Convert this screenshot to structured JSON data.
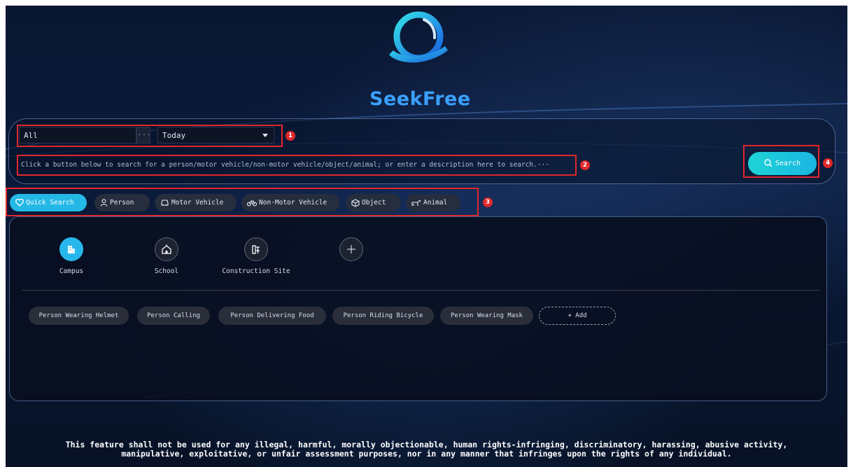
{
  "app": {
    "name": "SeekFree"
  },
  "filters": {
    "scope_value": "All",
    "scope_more": "···",
    "time_value": "Today"
  },
  "search": {
    "placeholder": "Click a button below to search for a person/motor vehicle/non-motor vehicle/object/animal; or enter a description here to search.···",
    "button_label": "Search"
  },
  "tabs": [
    {
      "label": "Quick Search",
      "icon": "heart-icon",
      "active": true
    },
    {
      "label": "Person",
      "icon": "person-icon"
    },
    {
      "label": "Motor Vehicle",
      "icon": "car-icon"
    },
    {
      "label": "Non-Motor Vehicle",
      "icon": "bicycle-icon"
    },
    {
      "label": "Object",
      "icon": "cube-icon"
    },
    {
      "label": "Animal",
      "icon": "animal-icon"
    }
  ],
  "scenes": [
    {
      "label": "Campus",
      "icon": "building-icon",
      "active": true
    },
    {
      "label": "School",
      "icon": "school-icon"
    },
    {
      "label": "Construction Site",
      "icon": "construction-icon"
    },
    {
      "label": "",
      "icon": "plus-icon"
    }
  ],
  "quick_tags": [
    "Person Wearing Helmet",
    "Person Calling",
    "Person Delivering Food",
    "Person Riding Bicycle",
    "Person Wearing Mask"
  ],
  "add_label": "+ Add",
  "annotations": [
    "1",
    "2",
    "3",
    "4"
  ],
  "colors": {
    "accent": "#24b8e6",
    "annotation": "#e0272b",
    "background": "#0a1733"
  },
  "disclaimer": {
    "line1": "This feature shall not be used for any illegal, harmful, morally objectionable, human rights-infringing, discriminatory, harassing, abusive activity,",
    "line2": "manipulative, exploitative, or unfair assessment purposes, nor in any manner that infringes upon the rights of any individual."
  }
}
